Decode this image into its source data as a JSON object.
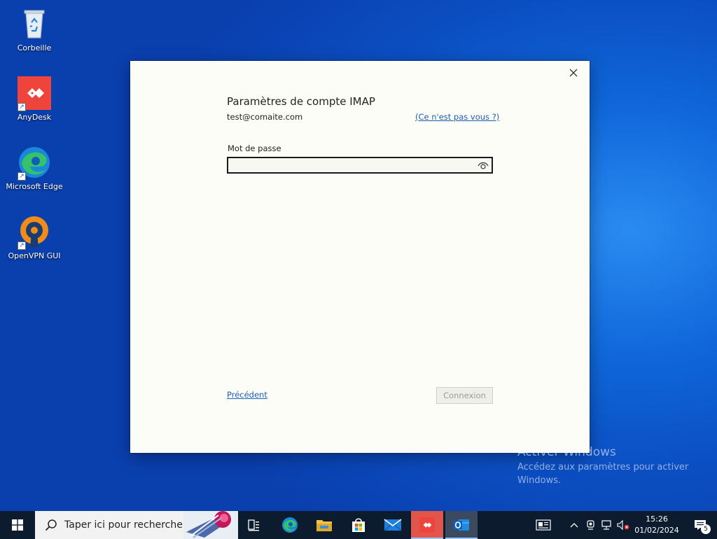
{
  "desktop": {
    "icons": [
      {
        "label": "Corbeille",
        "icon": "recycle-bin-icon"
      },
      {
        "label": "AnyDesk",
        "icon": "anydesk-icon",
        "shortcut": true,
        "color": "#ef443b"
      },
      {
        "label": "Microsoft Edge",
        "icon": "edge-icon",
        "shortcut": true
      },
      {
        "label": "OpenVPN GUI",
        "icon": "openvpn-icon",
        "shortcut": true,
        "color": "#f08c1c"
      }
    ]
  },
  "dialog": {
    "title": "Paramètres de compte IMAP",
    "email": "test@comaite.com",
    "not_you_link": "(Ce n'est pas vous ?)",
    "password_label": "Mot de passe",
    "password_value": "",
    "previous_link": "Précédent",
    "connect_button": "Connexion",
    "close_icon": "close-icon"
  },
  "watermark": {
    "title": "Activer Windows",
    "subtitle": "Accédez aux paramètres pour activer Windows."
  },
  "taskbar": {
    "search_placeholder": "Taper ici pour rechercher",
    "pinned": [
      "task-view-icon",
      "edge-icon",
      "file-explorer-icon",
      "store-icon",
      "mail-icon",
      "anydesk-icon",
      "outlook-icon"
    ],
    "time": "15:26",
    "date": "01/02/2024",
    "notification_count": "5"
  },
  "colors": {
    "desktop_blue": "#0b4fc3",
    "taskbar": "#0c1b2e",
    "link": "#1a5fb4",
    "anydesk_red": "#ef443b"
  }
}
